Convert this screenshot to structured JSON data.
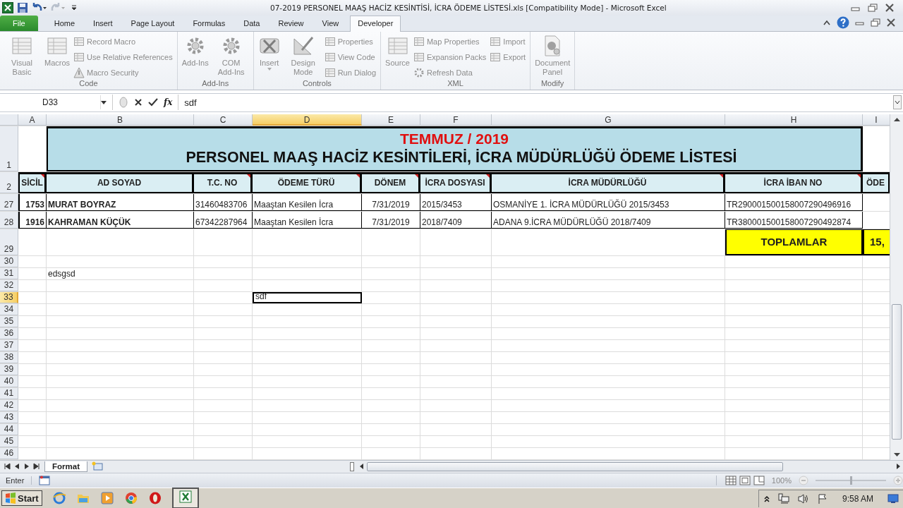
{
  "window": {
    "title": "07-2019 PERSONEL MAAŞ HACİZ KESİNTİSİ, İCRA ÖDEME LİSTESİ.xls  [Compatibility Mode]  -  Microsoft Excel"
  },
  "tabs": [
    {
      "label": "File",
      "kind": "file",
      "selected": false
    },
    {
      "label": "Home",
      "kind": "tab",
      "selected": false
    },
    {
      "label": "Insert",
      "kind": "tab",
      "selected": false
    },
    {
      "label": "Page Layout",
      "kind": "tab",
      "selected": false
    },
    {
      "label": "Formulas",
      "kind": "tab",
      "selected": false
    },
    {
      "label": "Data",
      "kind": "tab",
      "selected": false
    },
    {
      "label": "Review",
      "kind": "tab",
      "selected": false
    },
    {
      "label": "View",
      "kind": "tab",
      "selected": false
    },
    {
      "label": "Developer",
      "kind": "tab",
      "selected": true
    }
  ],
  "ribbon": {
    "groups": [
      {
        "label": "Code",
        "items": [
          {
            "label": "Visual Basic",
            "kind": "large",
            "disabled": true
          },
          {
            "label": "Macros",
            "kind": "large",
            "disabled": true
          },
          {
            "label": "Record Macro",
            "kind": "small",
            "disabled": true
          },
          {
            "label": "Use Relative References",
            "kind": "small",
            "disabled": true
          },
          {
            "label": "Macro Security",
            "kind": "small",
            "disabled": true
          }
        ]
      },
      {
        "label": "Add-Ins",
        "items": [
          {
            "label": "Add-Ins",
            "kind": "large",
            "disabled": true
          },
          {
            "label": "COM Add-Ins",
            "kind": "large",
            "disabled": true
          }
        ]
      },
      {
        "label": "Controls",
        "items": [
          {
            "label": "Insert",
            "kind": "menu",
            "disabled": true
          },
          {
            "label": "Design Mode",
            "kind": "large",
            "disabled": true
          },
          {
            "label": "Properties",
            "kind": "small",
            "disabled": true
          },
          {
            "label": "View Code",
            "kind": "small",
            "disabled": true
          },
          {
            "label": "Run Dialog",
            "kind": "small",
            "disabled": true
          }
        ]
      },
      {
        "label": "XML",
        "items": [
          {
            "label": "Source",
            "kind": "large",
            "disabled": true
          },
          {
            "label": "Map Properties",
            "kind": "small",
            "disabled": true
          },
          {
            "label": "Expansion Packs",
            "kind": "small",
            "disabled": true
          },
          {
            "label": "Refresh Data",
            "kind": "small",
            "disabled": true
          },
          {
            "label": "Import",
            "kind": "small",
            "disabled": true
          },
          {
            "label": "Export",
            "kind": "small",
            "disabled": true
          }
        ]
      },
      {
        "label": "Modify",
        "items": [
          {
            "label": "Document Panel",
            "kind": "large",
            "disabled": true
          }
        ]
      }
    ]
  },
  "formula_bar": {
    "name_box": "D33",
    "function_label": "fx",
    "formula": "sdf"
  },
  "sheet": {
    "columns": [
      {
        "label": "A",
        "selected": false
      },
      {
        "label": "B",
        "selected": false
      },
      {
        "label": "C",
        "selected": false
      },
      {
        "label": "D",
        "selected": true
      },
      {
        "label": "E",
        "selected": false
      },
      {
        "label": "F",
        "selected": false
      },
      {
        "label": "G",
        "selected": false
      },
      {
        "label": "H",
        "selected": false
      },
      {
        "label": "I",
        "selected": false
      }
    ],
    "rows": [
      {
        "number": "1",
        "kind": "title",
        "selected": false,
        "lines": [
          "TEMMUZ / 2019",
          "PERSONEL MAAŞ HACİZ KESİNTİLERİ, İCRA MÜDÜRLÜĞÜ ÖDEME LİSTESİ"
        ]
      },
      {
        "number": "2",
        "kind": "header",
        "selected": false,
        "cells": [
          {
            "text": "SİCİL",
            "comment": true
          },
          {
            "text": "AD SOYAD",
            "comment": false
          },
          {
            "text": "T.C. NO",
            "comment": true
          },
          {
            "text": "ÖDEME TÜRÜ",
            "comment": true
          },
          {
            "text": "DÖNEM",
            "comment": true
          },
          {
            "text": "İCRA DOSYASI",
            "comment": true
          },
          {
            "text": "İCRA MÜDÜRLÜĞÜ",
            "comment": true
          },
          {
            "text": "İCRA İBAN NO",
            "comment": true
          },
          {
            "text": "ÖDE",
            "comment": false
          }
        ]
      },
      {
        "number": "27",
        "kind": "data",
        "selected": false,
        "cells": [
          "1753",
          "MURAT BOYRAZ",
          "31460483706",
          "Maaştan Kesilen İcra",
          "7/31/2019",
          "2015/3453",
          "OSMANİYE 1. İCRA MÜDÜRLÜĞÜ 2015/3453",
          "TR290001500158007290496916"
        ]
      },
      {
        "number": "28",
        "kind": "data",
        "selected": false,
        "cells": [
          "1916",
          "KAHRAMAN KÜÇÜK",
          "67342287964",
          "Maaştan Kesilen İcra",
          "7/31/2019",
          "2018/7409",
          "ADANA 9.İCRA MÜDÜRLÜĞÜ 2018/7409",
          "TR380001500158007290492874"
        ]
      },
      {
        "number": "29",
        "kind": "total",
        "selected": false,
        "cells": [
          "TOPLAMLAR",
          "15,"
        ]
      },
      {
        "number": "30",
        "kind": "plain",
        "selected": false
      },
      {
        "number": "31",
        "kind": "note",
        "selected": false,
        "text": "edsgsd"
      },
      {
        "number": "32",
        "kind": "plain",
        "selected": false
      },
      {
        "number": "33",
        "kind": "plain",
        "selected": true,
        "text": "sdf"
      },
      {
        "number": "34",
        "kind": "plain",
        "selected": false
      },
      {
        "number": "35",
        "kind": "plain",
        "selected": false
      },
      {
        "number": "36",
        "kind": "plain",
        "selected": false
      },
      {
        "number": "37",
        "kind": "plain",
        "selected": false
      },
      {
        "number": "38",
        "kind": "plain",
        "selected": false
      },
      {
        "number": "39",
        "kind": "plain",
        "selected": false
      },
      {
        "number": "40",
        "kind": "plain",
        "selected": false
      },
      {
        "number": "41",
        "kind": "plain",
        "selected": false
      },
      {
        "number": "42",
        "kind": "plain",
        "selected": false
      },
      {
        "number": "43",
        "kind": "plain",
        "selected": false
      },
      {
        "number": "44",
        "kind": "plain",
        "selected": false
      },
      {
        "number": "45",
        "kind": "plain",
        "selected": false
      },
      {
        "number": "46",
        "kind": "plain",
        "selected": false
      }
    ]
  },
  "sheet_tabs": [
    {
      "label": "Format",
      "selected": true
    }
  ],
  "status_bar": {
    "mode": "Enter",
    "zoom": "100%",
    "zoom_slider": {
      "level": 0.5
    }
  },
  "taskbar": {
    "start": "Start",
    "time": "9:58 AM"
  }
}
